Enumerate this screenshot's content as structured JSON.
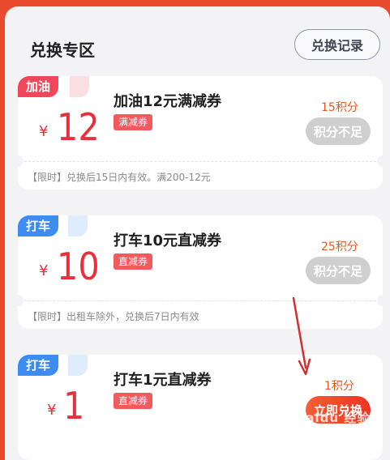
{
  "header": {
    "title": "兑换专区",
    "record_button": "兑换记录"
  },
  "cards": [
    {
      "tag": "加油",
      "currency": "¥",
      "amount": "12",
      "name": "加油12元满减券",
      "kind": "满减券",
      "points": "15积分",
      "button": "积分不足",
      "desc": "【限时】兑换后15日内有效。满200-12元"
    },
    {
      "tag": "打车",
      "currency": "¥",
      "amount": "10",
      "name": "打车10元直减券",
      "kind": "直减券",
      "points": "25积分",
      "button": "积分不足",
      "desc": "【限时】出租车除外，兑换后7日内有效"
    },
    {
      "tag": "打车",
      "currency": "¥",
      "amount": "1",
      "name": "打车1元直减券",
      "kind": "直减券",
      "points": "1积分",
      "button": "立即兑换"
    }
  ],
  "watermark": "Baidu 经验",
  "colors": {
    "accent": "#ea2e3c",
    "points": "#e65a1f",
    "tag_fuel": "#f0485a",
    "tag_taxi": "#3d8cf2",
    "arrow": "#d32f2f"
  }
}
